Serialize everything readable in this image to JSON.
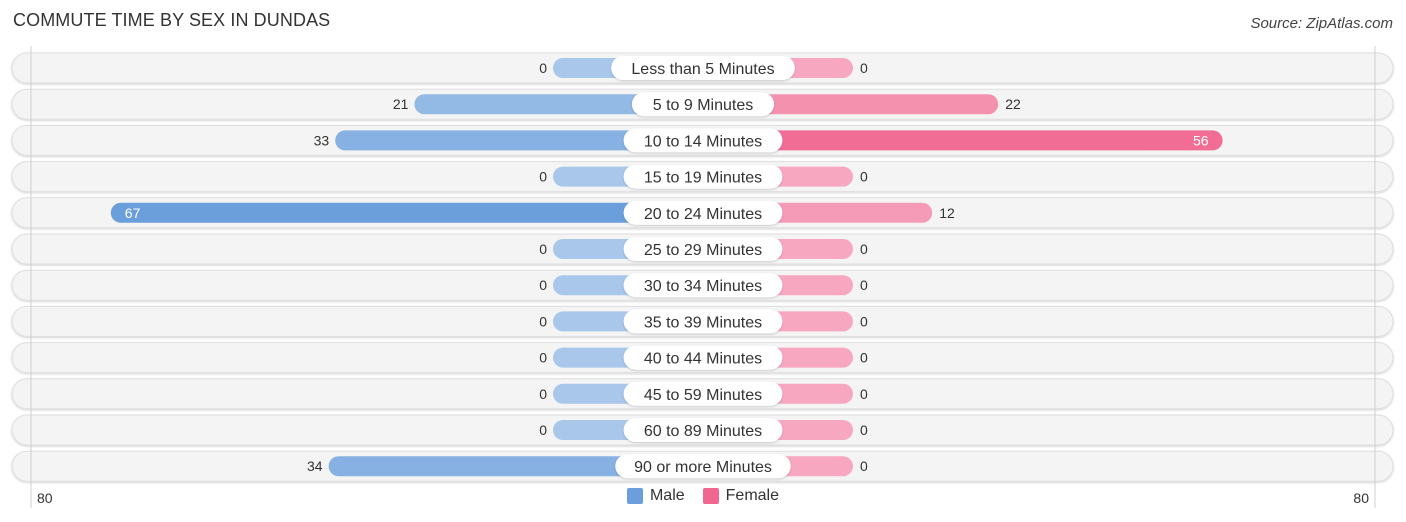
{
  "header": {
    "title": "COMMUTE TIME BY SEX IN DUNDAS",
    "source": "Source: ZipAtlas.com"
  },
  "colors": {
    "male": "#6a9fdc",
    "male_light": "#a9c7ea",
    "female": "#f06892",
    "female_light": "#f7a8c0"
  },
  "chart_data": {
    "type": "bar",
    "orientation": "horizontal-diverging",
    "title": "COMMUTE TIME BY SEX IN DUNDAS",
    "categories": [
      "Less than 5 Minutes",
      "5 to 9 Minutes",
      "10 to 14 Minutes",
      "15 to 19 Minutes",
      "20 to 24 Minutes",
      "25 to 29 Minutes",
      "30 to 34 Minutes",
      "35 to 39 Minutes",
      "40 to 44 Minutes",
      "45 to 59 Minutes",
      "60 to 89 Minutes",
      "90 or more Minutes"
    ],
    "series": [
      {
        "name": "Male",
        "values": [
          0,
          21,
          33,
          0,
          67,
          0,
          0,
          0,
          0,
          0,
          0,
          34
        ]
      },
      {
        "name": "Female",
        "values": [
          0,
          22,
          56,
          0,
          12,
          0,
          0,
          0,
          0,
          0,
          0,
          0
        ]
      }
    ],
    "axis": {
      "min_label": "80",
      "max_label": "80",
      "range": [
        -80,
        80
      ]
    },
    "legend": {
      "position": "bottom-center",
      "entries": [
        "Male",
        "Female"
      ]
    },
    "grid": false
  }
}
